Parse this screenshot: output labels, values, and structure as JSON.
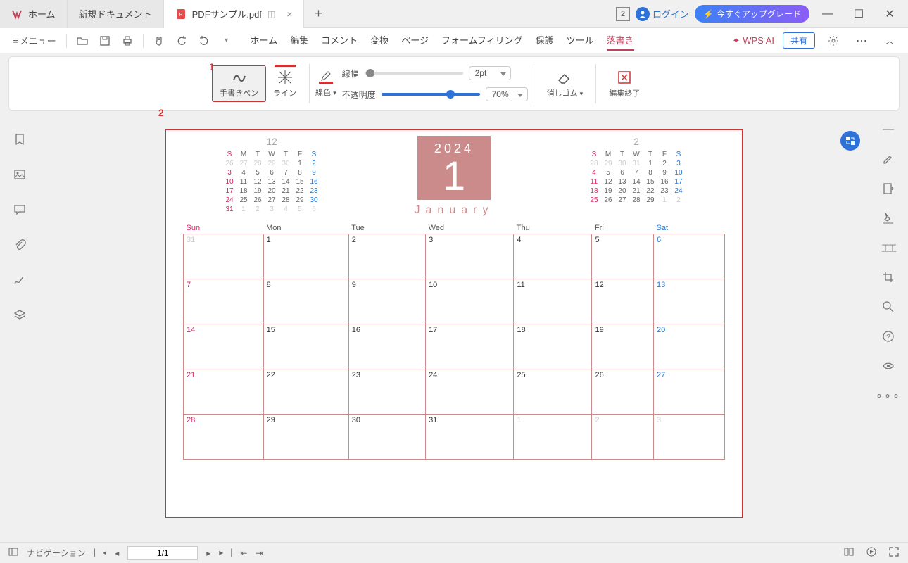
{
  "titlebar": {
    "tab_home": "ホーム",
    "tab_new": "新規ドキュメント",
    "tab_active": "PDFサンプル.pdf",
    "badge_num": "2",
    "login": "ログイン",
    "upgrade": "今すぐアップグレード"
  },
  "menubar": {
    "menu_label": "メニュー",
    "tabs": {
      "home": "ホーム",
      "edit": "編集",
      "comment": "コメント",
      "convert": "変換",
      "page": "ページ",
      "form": "フォームフィリング",
      "protect": "保護",
      "tool": "ツール",
      "sketch": "落書き"
    },
    "wps_ai": "WPS AI",
    "share": "共有"
  },
  "ribbon": {
    "pen": "手書きペン",
    "line": "ライン",
    "line_color": "線色",
    "line_width_label": "線幅",
    "line_width_val": "2pt",
    "opacity_label": "不透明度",
    "opacity_val": "70%",
    "eraser": "消しゴム",
    "end_edit": "編集終了",
    "annot1": "1",
    "annot2": "2"
  },
  "calendar": {
    "year": "2024",
    "month_num": "1",
    "month_name": "January",
    "mini_left_title": "12",
    "mini_right_title": "2",
    "dow": {
      "sun": "S",
      "mon": "M",
      "tue": "T",
      "wed": "W",
      "thu": "T",
      "fri": "F",
      "sat": "S"
    },
    "main_dow": {
      "sun": "Sun",
      "mon": "Mon",
      "tue": "Tue",
      "wed": "Wed",
      "thu": "Thu",
      "fri": "Fri",
      "sat": "Sat"
    },
    "mini_left": [
      [
        "26",
        "27",
        "28",
        "29",
        "30",
        "1",
        "2"
      ],
      [
        "3",
        "4",
        "5",
        "6",
        "7",
        "8",
        "9"
      ],
      [
        "10",
        "11",
        "12",
        "13",
        "14",
        "15",
        "16"
      ],
      [
        "17",
        "18",
        "19",
        "20",
        "21",
        "22",
        "23"
      ],
      [
        "24",
        "25",
        "26",
        "27",
        "28",
        "29",
        "30"
      ],
      [
        "31",
        "1",
        "2",
        "3",
        "4",
        "5",
        "6"
      ]
    ],
    "mini_right": [
      [
        "28",
        "29",
        "30",
        "31",
        "1",
        "2",
        "3"
      ],
      [
        "4",
        "5",
        "6",
        "7",
        "8",
        "9",
        "10"
      ],
      [
        "11",
        "12",
        "13",
        "14",
        "15",
        "16",
        "17"
      ],
      [
        "18",
        "19",
        "20",
        "21",
        "22",
        "23",
        "24"
      ],
      [
        "25",
        "26",
        "27",
        "28",
        "29",
        "1",
        "2"
      ]
    ],
    "main": [
      [
        "31",
        "1",
        "2",
        "3",
        "4",
        "5",
        "6"
      ],
      [
        "7",
        "8",
        "9",
        "10",
        "11",
        "12",
        "13"
      ],
      [
        "14",
        "15",
        "16",
        "17",
        "18",
        "19",
        "20"
      ],
      [
        "21",
        "22",
        "23",
        "24",
        "25",
        "26",
        "27"
      ],
      [
        "28",
        "29",
        "30",
        "31",
        "1",
        "2",
        "3"
      ]
    ]
  },
  "statusbar": {
    "nav_label": "ナビゲーション",
    "page": "1/1"
  }
}
